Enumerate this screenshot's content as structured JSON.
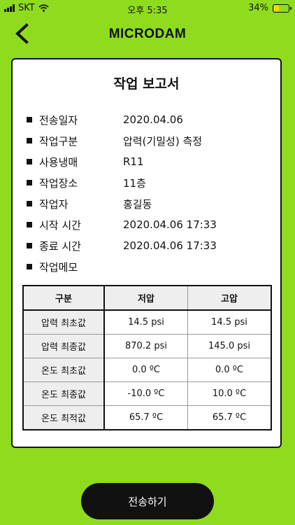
{
  "status_bar": {
    "carrier": "SKT",
    "time": "오후 5:35",
    "battery": "34%",
    "battery_level": 0.34
  },
  "header": {
    "logo": "MICRODAM"
  },
  "report": {
    "title": "작업 보고서",
    "fields": [
      {
        "label": "전송일자",
        "value": "2020.04.06"
      },
      {
        "label": "작업구분",
        "value": "압력(기밀성) 측정"
      },
      {
        "label": "사용냉매",
        "value": "R11"
      },
      {
        "label": "작업장소",
        "value": "11층"
      },
      {
        "label": "작업자",
        "value": "홍길동"
      },
      {
        "label": "시작 시간",
        "value": "2020.04.06 17:33"
      },
      {
        "label": "종료 시간",
        "value": "2020.04.06 17:33"
      },
      {
        "label": "작업메모",
        "value": ""
      }
    ]
  },
  "table": {
    "headers": [
      "구분",
      "저압",
      "고압"
    ],
    "rows": [
      [
        "압력 최초값",
        "14.5 psi",
        "14.5 psi"
      ],
      [
        "압력 최종값",
        "870.2 psi",
        "145.0 psi"
      ],
      [
        "온도 최초값",
        "0.0 ºC",
        "0.0 ºC"
      ],
      [
        "온도 최종값",
        "-10.0 ºC",
        "10.0 ºC"
      ],
      [
        "온도 최적값",
        "65.7 ºC",
        "65.7 ºC"
      ]
    ]
  },
  "actions": {
    "send_label": "전송하기"
  },
  "icons": {
    "back": "chevron-left-icon",
    "wifi": "wifi-icon",
    "signal": "signal-icon",
    "battery": "battery-icon",
    "charging": "charging-bolt-icon"
  },
  "colors": {
    "background": "#8fdc1e",
    "button": "#111111",
    "battery_fill": "#ffd400"
  }
}
